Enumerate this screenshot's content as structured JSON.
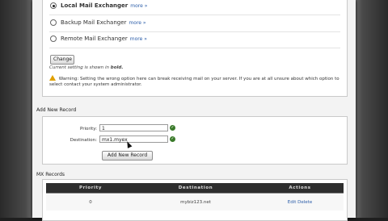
{
  "options": {
    "local": {
      "label": "Local Mail Exchanger",
      "more": "more »",
      "selected": true
    },
    "backup": {
      "label": "Backup Mail Exchanger",
      "more": "more »",
      "selected": false
    },
    "remote": {
      "label": "Remote Mail Exchanger",
      "more": "more »",
      "selected": false
    }
  },
  "change_button": "Change",
  "current_setting_note_prefix": "Current setting is shown in",
  "current_setting_note_bold": "bold.",
  "warning_text": "Warning: Setting the wrong option here can break receiving mail on your server. If you are at all unsure about which option to select contact your system administrator.",
  "add_record": {
    "title": "Add New Record",
    "priority_label": "Priority:",
    "priority_value": "1",
    "destination_label": "Destination:",
    "destination_value": "mx1.myex",
    "add_button": "Add New Record"
  },
  "mx_records": {
    "title": "MX Records",
    "columns": [
      "Priority",
      "Destination",
      "Actions"
    ],
    "rows": [
      {
        "priority": "0",
        "destination": "mybiz123.net",
        "edit": "Edit",
        "delete": "Delete"
      }
    ]
  },
  "colors": {
    "link": "#2a5ca8",
    "valid": "#3a7a2a",
    "warning": "#e0a000",
    "table_header": "#2e2e2e"
  }
}
